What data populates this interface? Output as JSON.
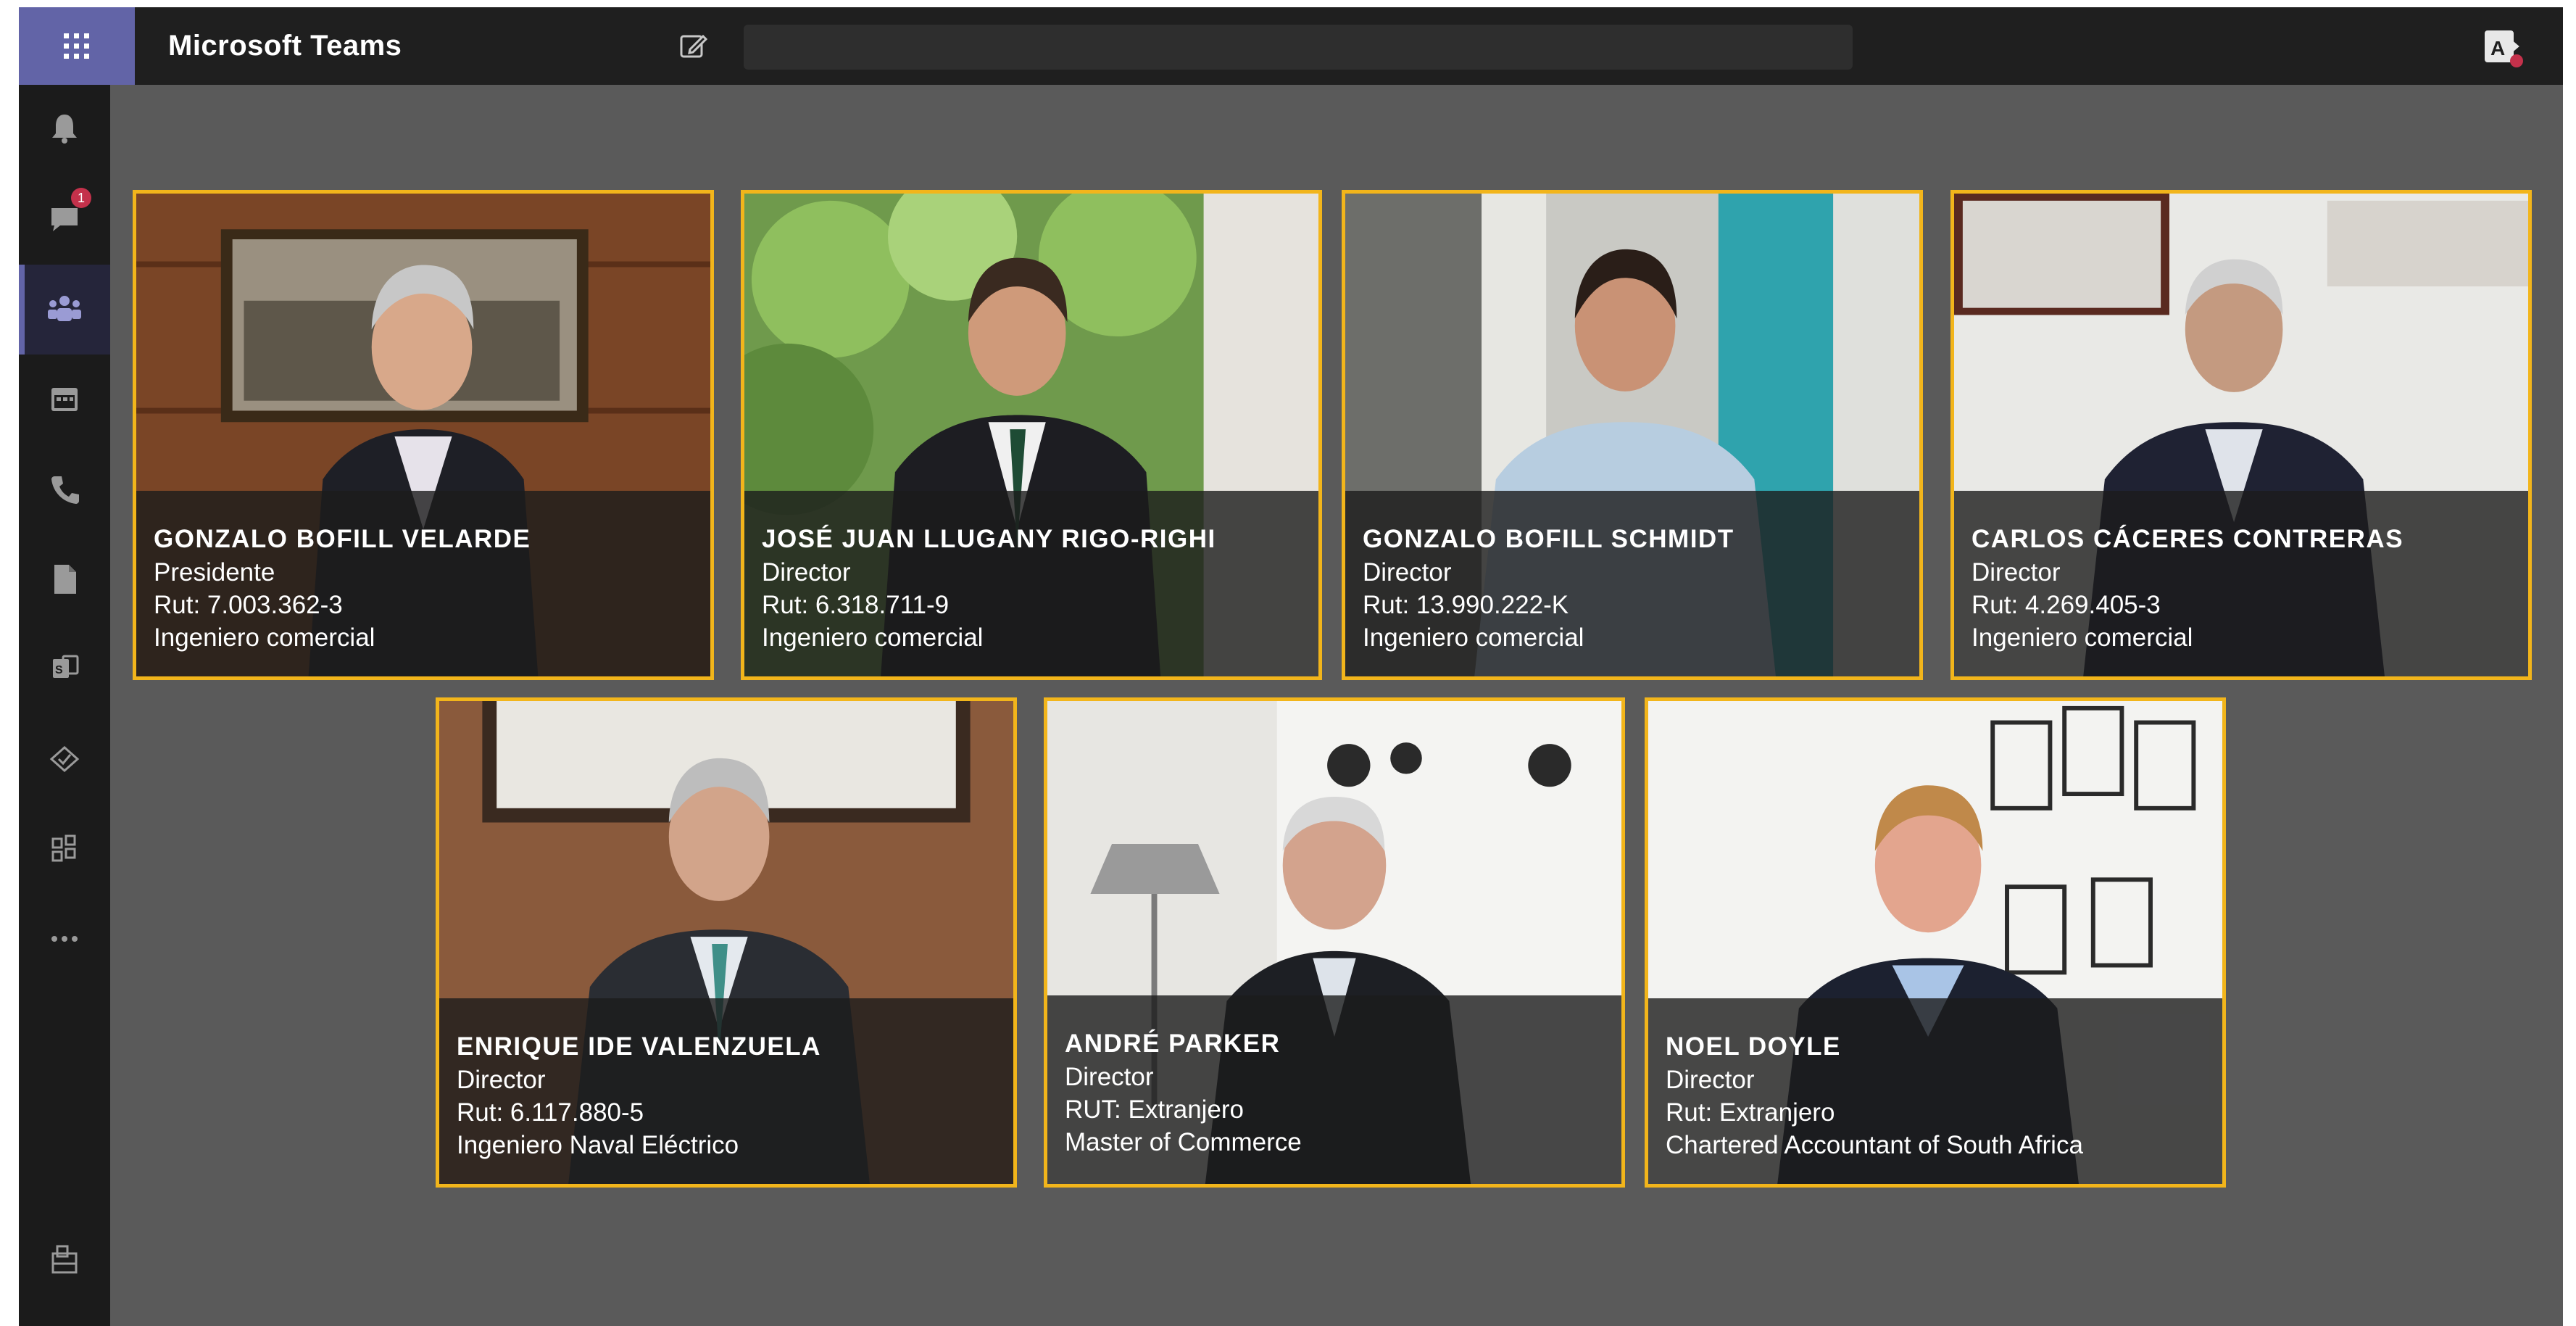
{
  "app": {
    "title": "Microsoft Teams"
  },
  "sidebar": {
    "badge_count": "1"
  },
  "board": [
    {
      "name": "GONZALO BOFILL VELARDE",
      "role": "Presidente",
      "rut": "Rut: 7.003.362-3",
      "profession": "Ingeniero comercial"
    },
    {
      "name": "JOSÉ JUAN LLUGANY RIGO-RIGHI",
      "role": "Director",
      "rut": "Rut: 6.318.711-9",
      "profession": "Ingeniero comercial"
    },
    {
      "name": "GONZALO BOFILL SCHMIDT",
      "role": "Director",
      "rut": "Rut: 13.990.222-K",
      "profession": "Ingeniero comercial"
    },
    {
      "name": "CARLOS CÁCERES CONTRERAS",
      "role": "Director",
      "rut": "Rut: 4.269.405-3",
      "profession": "Ingeniero comercial"
    },
    {
      "name": "ENRIQUE IDE VALENZUELA",
      "role": "Director",
      "rut": "Rut: 6.117.880-5",
      "profession": "Ingeniero Naval Eléctrico"
    },
    {
      "name": "ANDRÉ PARKER",
      "role": "Director",
      "rut": "RUT: Extranjero",
      "profession": "Master of Commerce"
    },
    {
      "name": "NOEL DOYLE",
      "role": "Director",
      "rut": "Rut: Extranjero",
      "profession": "Chartered Accountant of South Africa"
    }
  ],
  "colors": {
    "app_background": "#5a5a5a",
    "topbar": "#1f1f1f",
    "rail": "#1b1b1b",
    "accent": "#6264a7",
    "card_border": "#f2b51b",
    "badge": "#c4314b"
  },
  "icons": [
    "waffle-icon",
    "compose-icon",
    "account-icon",
    "bell-icon",
    "chat-icon",
    "teams-icon",
    "calendar-icon",
    "call-icon",
    "files-icon",
    "app-icon",
    "tasks-icon",
    "apps-icon",
    "more-icon",
    "store-icon"
  ]
}
